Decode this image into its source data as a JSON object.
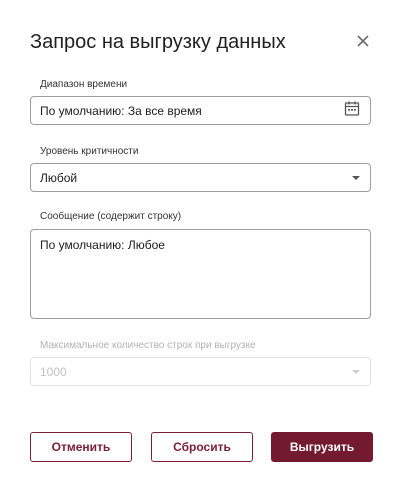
{
  "dialog": {
    "title": "Запрос на выгрузку данных"
  },
  "fields": {
    "time_range": {
      "label": "Диапазон времени",
      "value": "По умолчанию: За все время",
      "icon": "calendar-icon"
    },
    "severity": {
      "label": "Уровень критичности",
      "value": "Любой",
      "icon": "chevron-down-icon"
    },
    "message": {
      "label": "Сообщение (содержит строку)",
      "value": "По умолчанию: Любое"
    },
    "max_rows": {
      "label": "Максимальное количество строк при выгрузке",
      "value": "1000",
      "disabled": true
    }
  },
  "buttons": {
    "cancel": "Отменить",
    "reset": "Сбросить",
    "export": "Выгрузить"
  },
  "colors": {
    "accent": "#741a30",
    "border": "#9e9e9e",
    "disabled_text": "#c2c2c2"
  }
}
